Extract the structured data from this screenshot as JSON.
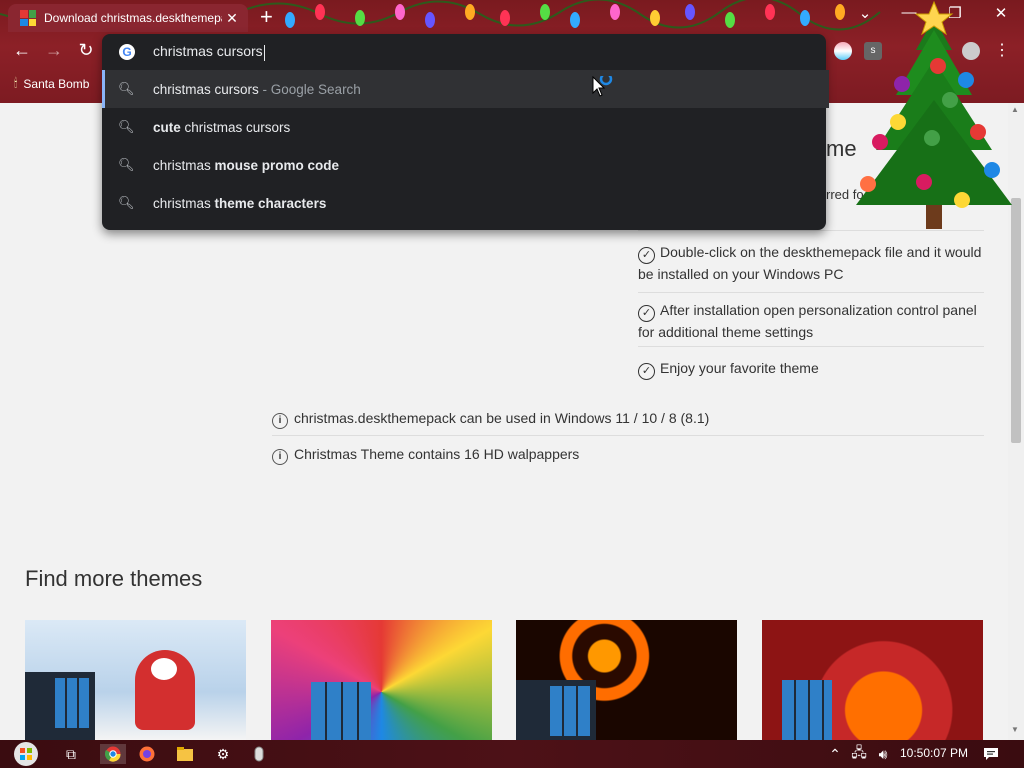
{
  "browser": {
    "tab_title": "Download christmas.deskthemepack",
    "bookmark_label": "Santa Bomb",
    "omnibox_text": "christmas cursors"
  },
  "suggestions": [
    {
      "bold_before": "",
      "plain": "christmas cursors",
      "bold_after": "",
      "sub": " - Google Search",
      "selected": true
    },
    {
      "bold_before": "cute",
      "plain": " christmas cursors",
      "bold_after": "",
      "sub": "",
      "selected": false
    },
    {
      "bold_before": "",
      "plain": "christmas ",
      "bold_after": "mouse promo code",
      "sub": "",
      "selected": false
    },
    {
      "bold_before": "",
      "plain": "christmas ",
      "bold_after": "theme characters",
      "sub": "",
      "selected": false
    }
  ],
  "page": {
    "heading_fragment": "me",
    "subtext_fragment": "rred fo",
    "steps": [
      "Double-click on the deskthemepack file and it would be installed on your Windows PC",
      "After installation open personalization control panel for additional theme settings",
      "Enjoy your favorite theme"
    ],
    "info": [
      "christmas.deskthemepack can be used in Windows 11 / 10 / 8 (8.1)",
      "Christmas Theme contains 16 HD walpappers"
    ],
    "find_more": "Find more themes"
  },
  "taskbar": {
    "clock": "10:50:07 PM"
  },
  "icons": [
    "back-icon",
    "forward-icon",
    "reload-icon",
    "google-icon",
    "search-icon",
    "info-icon",
    "check-icon",
    "minimize-icon",
    "maximize-icon",
    "close-icon",
    "new-tab-icon"
  ]
}
